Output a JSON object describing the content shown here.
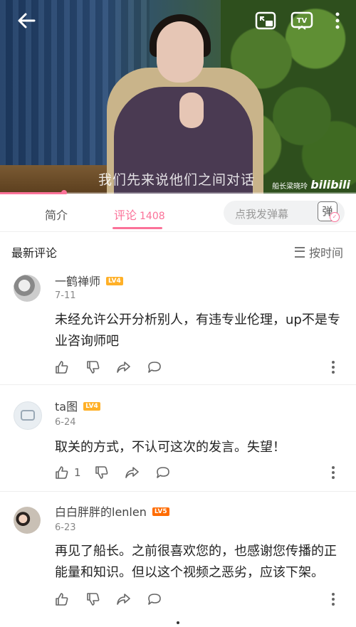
{
  "video": {
    "subtitle": "我们先来说他们之间对话",
    "watermark_user": "船长梁晓玲",
    "watermark_brand": "bilibili",
    "progress": 0.18,
    "accent": "#fb7299"
  },
  "tabs": {
    "intro": "简介",
    "comments": "评论",
    "comments_count": "1408",
    "danmu_placeholder": "点我发弹幕",
    "danmu_button": "弹"
  },
  "comments_section": {
    "title": "最新评论",
    "sort_label": "按时间"
  },
  "comments": [
    {
      "user": "一鹤禅师",
      "level": "LV4",
      "date": "7-11",
      "text": "未经允许公开分析别人，有违专业伦理，up不是专业咨询师吧",
      "likes": ""
    },
    {
      "user": "ta图",
      "level": "LV4",
      "date": "6-24",
      "text": "取关的方式，不认可这次的发言。失望！",
      "likes": "1"
    },
    {
      "user": "白白胖胖的lenlen",
      "level": "LV5",
      "date": "6-23",
      "text": "再见了船长。之前很喜欢您的，也感谢您传播的正能量和知识。但以这个视频之恶劣，应该下架。",
      "likes": ""
    }
  ]
}
